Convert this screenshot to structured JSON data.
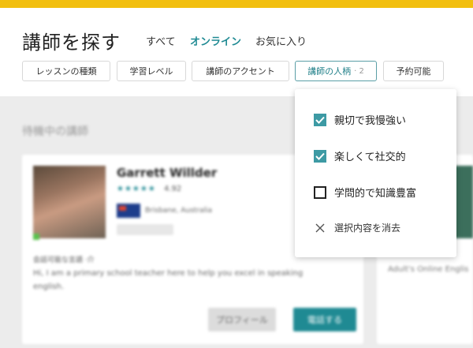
{
  "header": {
    "title": "講師を探す",
    "tabs": [
      {
        "label": "すべて"
      },
      {
        "label": "オンライン"
      },
      {
        "label": "お気に入り"
      }
    ],
    "filters": [
      {
        "label": "レッスンの種類"
      },
      {
        "label": "学習レベル"
      },
      {
        "label": "講師のアクセント"
      },
      {
        "label": "講師の人柄",
        "count": "· 2"
      },
      {
        "label": "予約可能"
      }
    ]
  },
  "dropdown": {
    "options": [
      {
        "label": "親切で我慢強い",
        "checked": true
      },
      {
        "label": "楽しくて社交的",
        "checked": true
      },
      {
        "label": "学問的で知識豊富",
        "checked": false
      }
    ],
    "clear_label": "選択内容を消去"
  },
  "content": {
    "section_label": "待機中の講師",
    "card": {
      "name": "Garrett Willder",
      "stars": "★★★★★",
      "rating": "4.92",
      "location": "Brisbane, Australia",
      "desc_heading": "会話可能な言語 ·介",
      "description": "Hi, I am a primary school teacher here to help you excel in speaking english.",
      "profile_button": "プロフィール",
      "book_button": "電話する"
    },
    "right_card": {
      "text": "Adult's Online Englis"
    }
  },
  "colors": {
    "accent": "#1f8a93",
    "topbar": "#f2bf0f",
    "checkbox": "#3d9aa4"
  }
}
